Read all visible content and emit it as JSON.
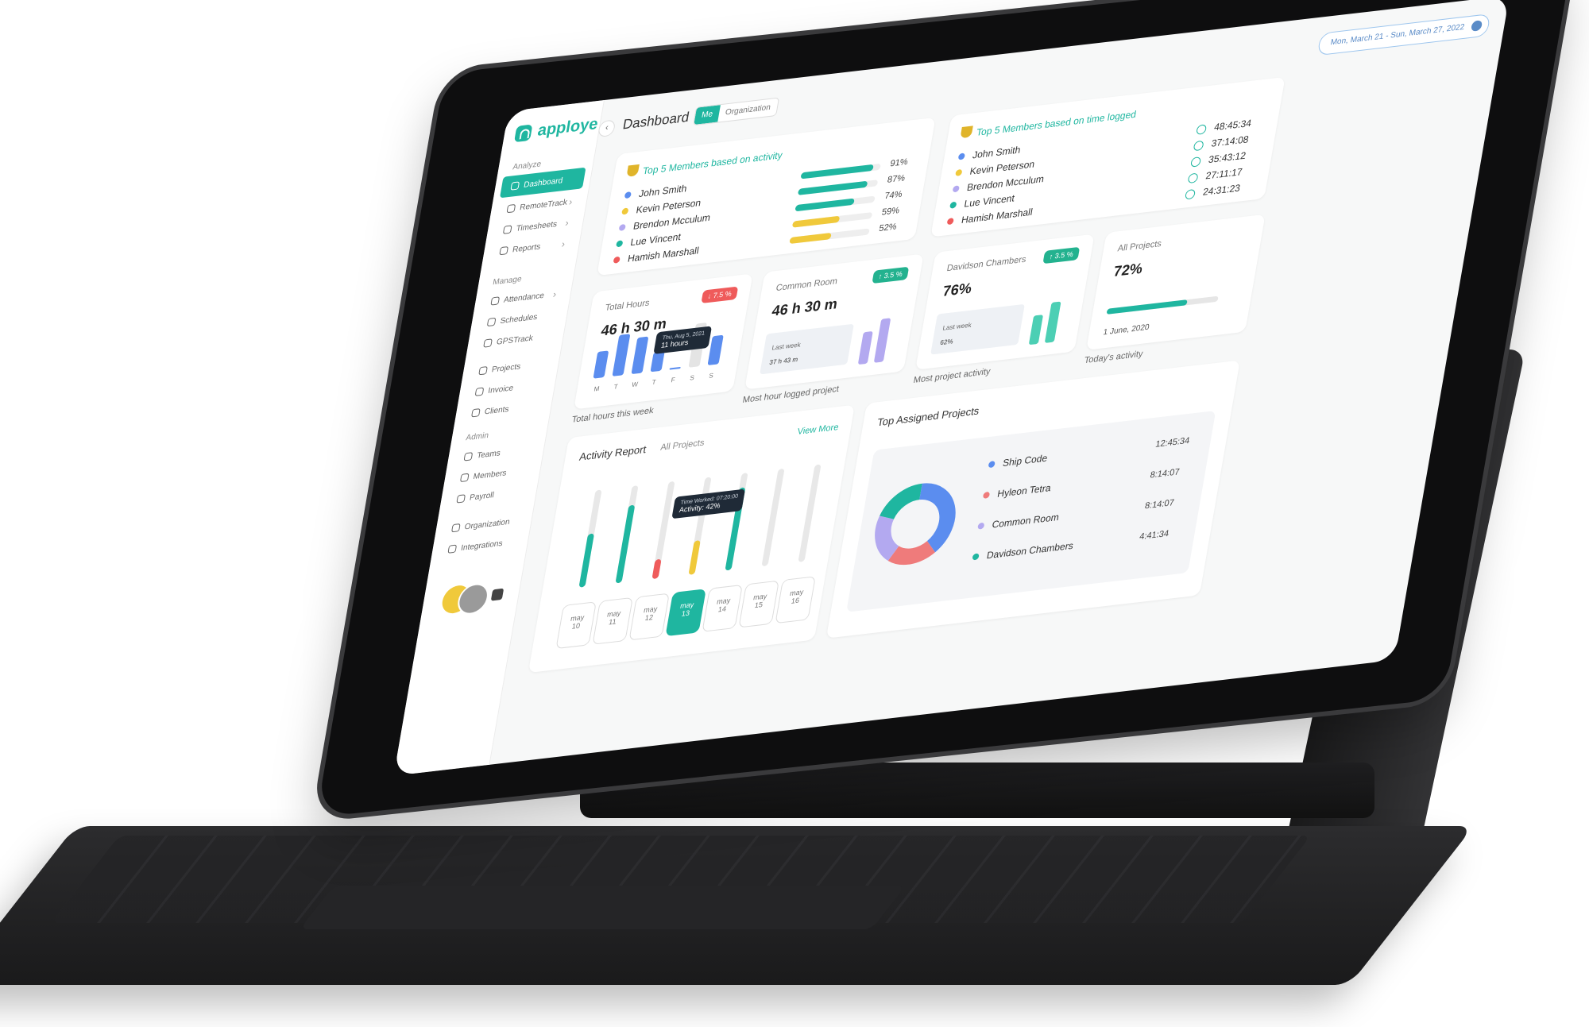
{
  "app": {
    "logo": "apploye",
    "page_title": "Dashboard"
  },
  "toggle": {
    "me": "Me",
    "organization": "Organization"
  },
  "date_range": "Mon, March 21 - Sun, March 27, 2022",
  "colors": {
    "accent": "#1fb6a0",
    "blue": "#5b8def",
    "yellow": "#f0c93b",
    "purple": "#b3a9f0",
    "red": "#ef5b5b",
    "green_badge": "#23b28f"
  },
  "sidebar": {
    "sections": [
      {
        "label": "Analyze"
      },
      {
        "label": "Manage"
      },
      {
        "label": "Admin"
      }
    ],
    "items": [
      {
        "label": "Dashboard",
        "icon": "dashboard-icon"
      },
      {
        "label": "RemoteTrack",
        "icon": "activity-icon"
      },
      {
        "label": "Timesheets",
        "icon": "timesheet-icon"
      },
      {
        "label": "Reports",
        "icon": "report-icon"
      },
      {
        "label": "Attendance",
        "icon": "attendance-icon"
      },
      {
        "label": "Schedules",
        "icon": "calendar-icon"
      },
      {
        "label": "GPSTrack",
        "icon": "gps-icon"
      },
      {
        "label": "Projects",
        "icon": "project-icon"
      },
      {
        "label": "Invoice",
        "icon": "invoice-icon"
      },
      {
        "label": "Clients",
        "icon": "clients-icon"
      },
      {
        "label": "Teams",
        "icon": "teams-icon"
      },
      {
        "label": "Members",
        "icon": "members-icon"
      },
      {
        "label": "Payroll",
        "icon": "payroll-icon"
      },
      {
        "label": "Organization",
        "icon": "organization-icon"
      },
      {
        "label": "Integrations",
        "icon": "integrations-icon"
      }
    ]
  },
  "top_activity": {
    "title": "Top 5 Members based on activity",
    "members": [
      {
        "name": "John Smith",
        "pct": "91%",
        "value": 0.91,
        "color": "#5b8def",
        "bar": "#1fb6a0"
      },
      {
        "name": "Kevin Peterson",
        "pct": "87%",
        "value": 0.87,
        "color": "#f0c93b",
        "bar": "#1fb6a0"
      },
      {
        "name": "Brendon Mcculum",
        "pct": "74%",
        "value": 0.74,
        "color": "#b3a9f0",
        "bar": "#1fb6a0"
      },
      {
        "name": "Lue Vincent",
        "pct": "59%",
        "value": 0.59,
        "color": "#1fb6a0",
        "bar": "#f0c93b"
      },
      {
        "name": "Hamish Marshall",
        "pct": "52%",
        "value": 0.52,
        "color": "#ef5b5b",
        "bar": "#f0c93b"
      }
    ]
  },
  "top_time": {
    "title": "Top 5 Members based on time logged",
    "members": [
      {
        "name": "John Smith",
        "time": "48:45:34",
        "color": "#5b8def"
      },
      {
        "name": "Kevin Peterson",
        "time": "37:14:08",
        "color": "#f0c93b"
      },
      {
        "name": "Brendon Mcculum",
        "time": "35:43:12",
        "color": "#b3a9f0"
      },
      {
        "name": "Lue Vincent",
        "time": "27:11:17",
        "color": "#1fb6a0"
      },
      {
        "name": "Hamish Marshall",
        "time": "24:31:23",
        "color": "#ef5b5b"
      }
    ]
  },
  "stats": {
    "total_hours": {
      "label": "Total Hours",
      "value": "46 h 30 m",
      "badge": "↓ 7.5 %",
      "caption": "Total hours this week",
      "tooltip_date": "Thu, Aug 5, 2021",
      "tooltip_value": "11 hours",
      "days": [
        "M",
        "T",
        "W",
        "T",
        "F",
        "S",
        "S"
      ],
      "bars": [
        0.55,
        0.85,
        0.75,
        0.4,
        0.0,
        0.9,
        0.6
      ]
    },
    "common_room": {
      "label": "Common Room",
      "value": "46 h 30 m",
      "badge": "↑ 3.5 %",
      "caption": "Most hour logged project",
      "last_week_label": "Last week",
      "last_week_value": "37 h 43 m"
    },
    "davidson": {
      "label": "Davidson Chambers",
      "value": "76%",
      "badge": "↑ 3.5 %",
      "caption": "Most project activity",
      "last_week_label": "Last week",
      "last_week_value": "62%"
    },
    "all_projects": {
      "label": "All Projects",
      "value": "72%",
      "progress": 0.72,
      "date": "1 June, 2020",
      "caption": "Today's activity"
    }
  },
  "activity_report": {
    "title": "Activity Report",
    "filter": "All Projects",
    "view_more": "View More",
    "tooltip_line1": "Time Worked: 07:20:00",
    "tooltip_line2": "Activity: 42%",
    "days": [
      {
        "m": "may",
        "d": "10",
        "levels": [
          0.55
        ],
        "colors": [
          "#1fb6a0"
        ]
      },
      {
        "m": "may",
        "d": "11",
        "levels": [
          0.8
        ],
        "colors": [
          "#1fb6a0"
        ]
      },
      {
        "m": "may",
        "d": "12",
        "levels": [
          0.2
        ],
        "colors": [
          "#ef5b5b"
        ]
      },
      {
        "m": "may",
        "d": "13",
        "levels": [
          0.35
        ],
        "colors": [
          "#f0c93b"
        ],
        "selected": true
      },
      {
        "m": "may",
        "d": "14",
        "levels": [
          0.85
        ],
        "colors": [
          "#1fb6a0"
        ]
      },
      {
        "m": "may",
        "d": "15",
        "levels": [
          0.0
        ],
        "colors": [
          "#1fb6a0"
        ]
      },
      {
        "m": "may",
        "d": "16",
        "levels": [
          0.0
        ],
        "colors": [
          "#1fb6a0"
        ]
      }
    ]
  },
  "top_projects": {
    "title": "Top Assigned Projects",
    "items": [
      {
        "name": "Ship Code",
        "time": "12:45:34",
        "color": "#5b8def",
        "share": 0.39
      },
      {
        "name": "Hyleon Tetra",
        "time": "8:14:07",
        "color": "#ef7b7b",
        "share": 0.2
      },
      {
        "name": "Common Room",
        "time": "8:14:07",
        "color": "#b3a9f0",
        "share": 0.21
      },
      {
        "name": "Davidson Chambers",
        "time": "4:41:34",
        "color": "#1fb6a0",
        "share": 0.2
      }
    ]
  }
}
